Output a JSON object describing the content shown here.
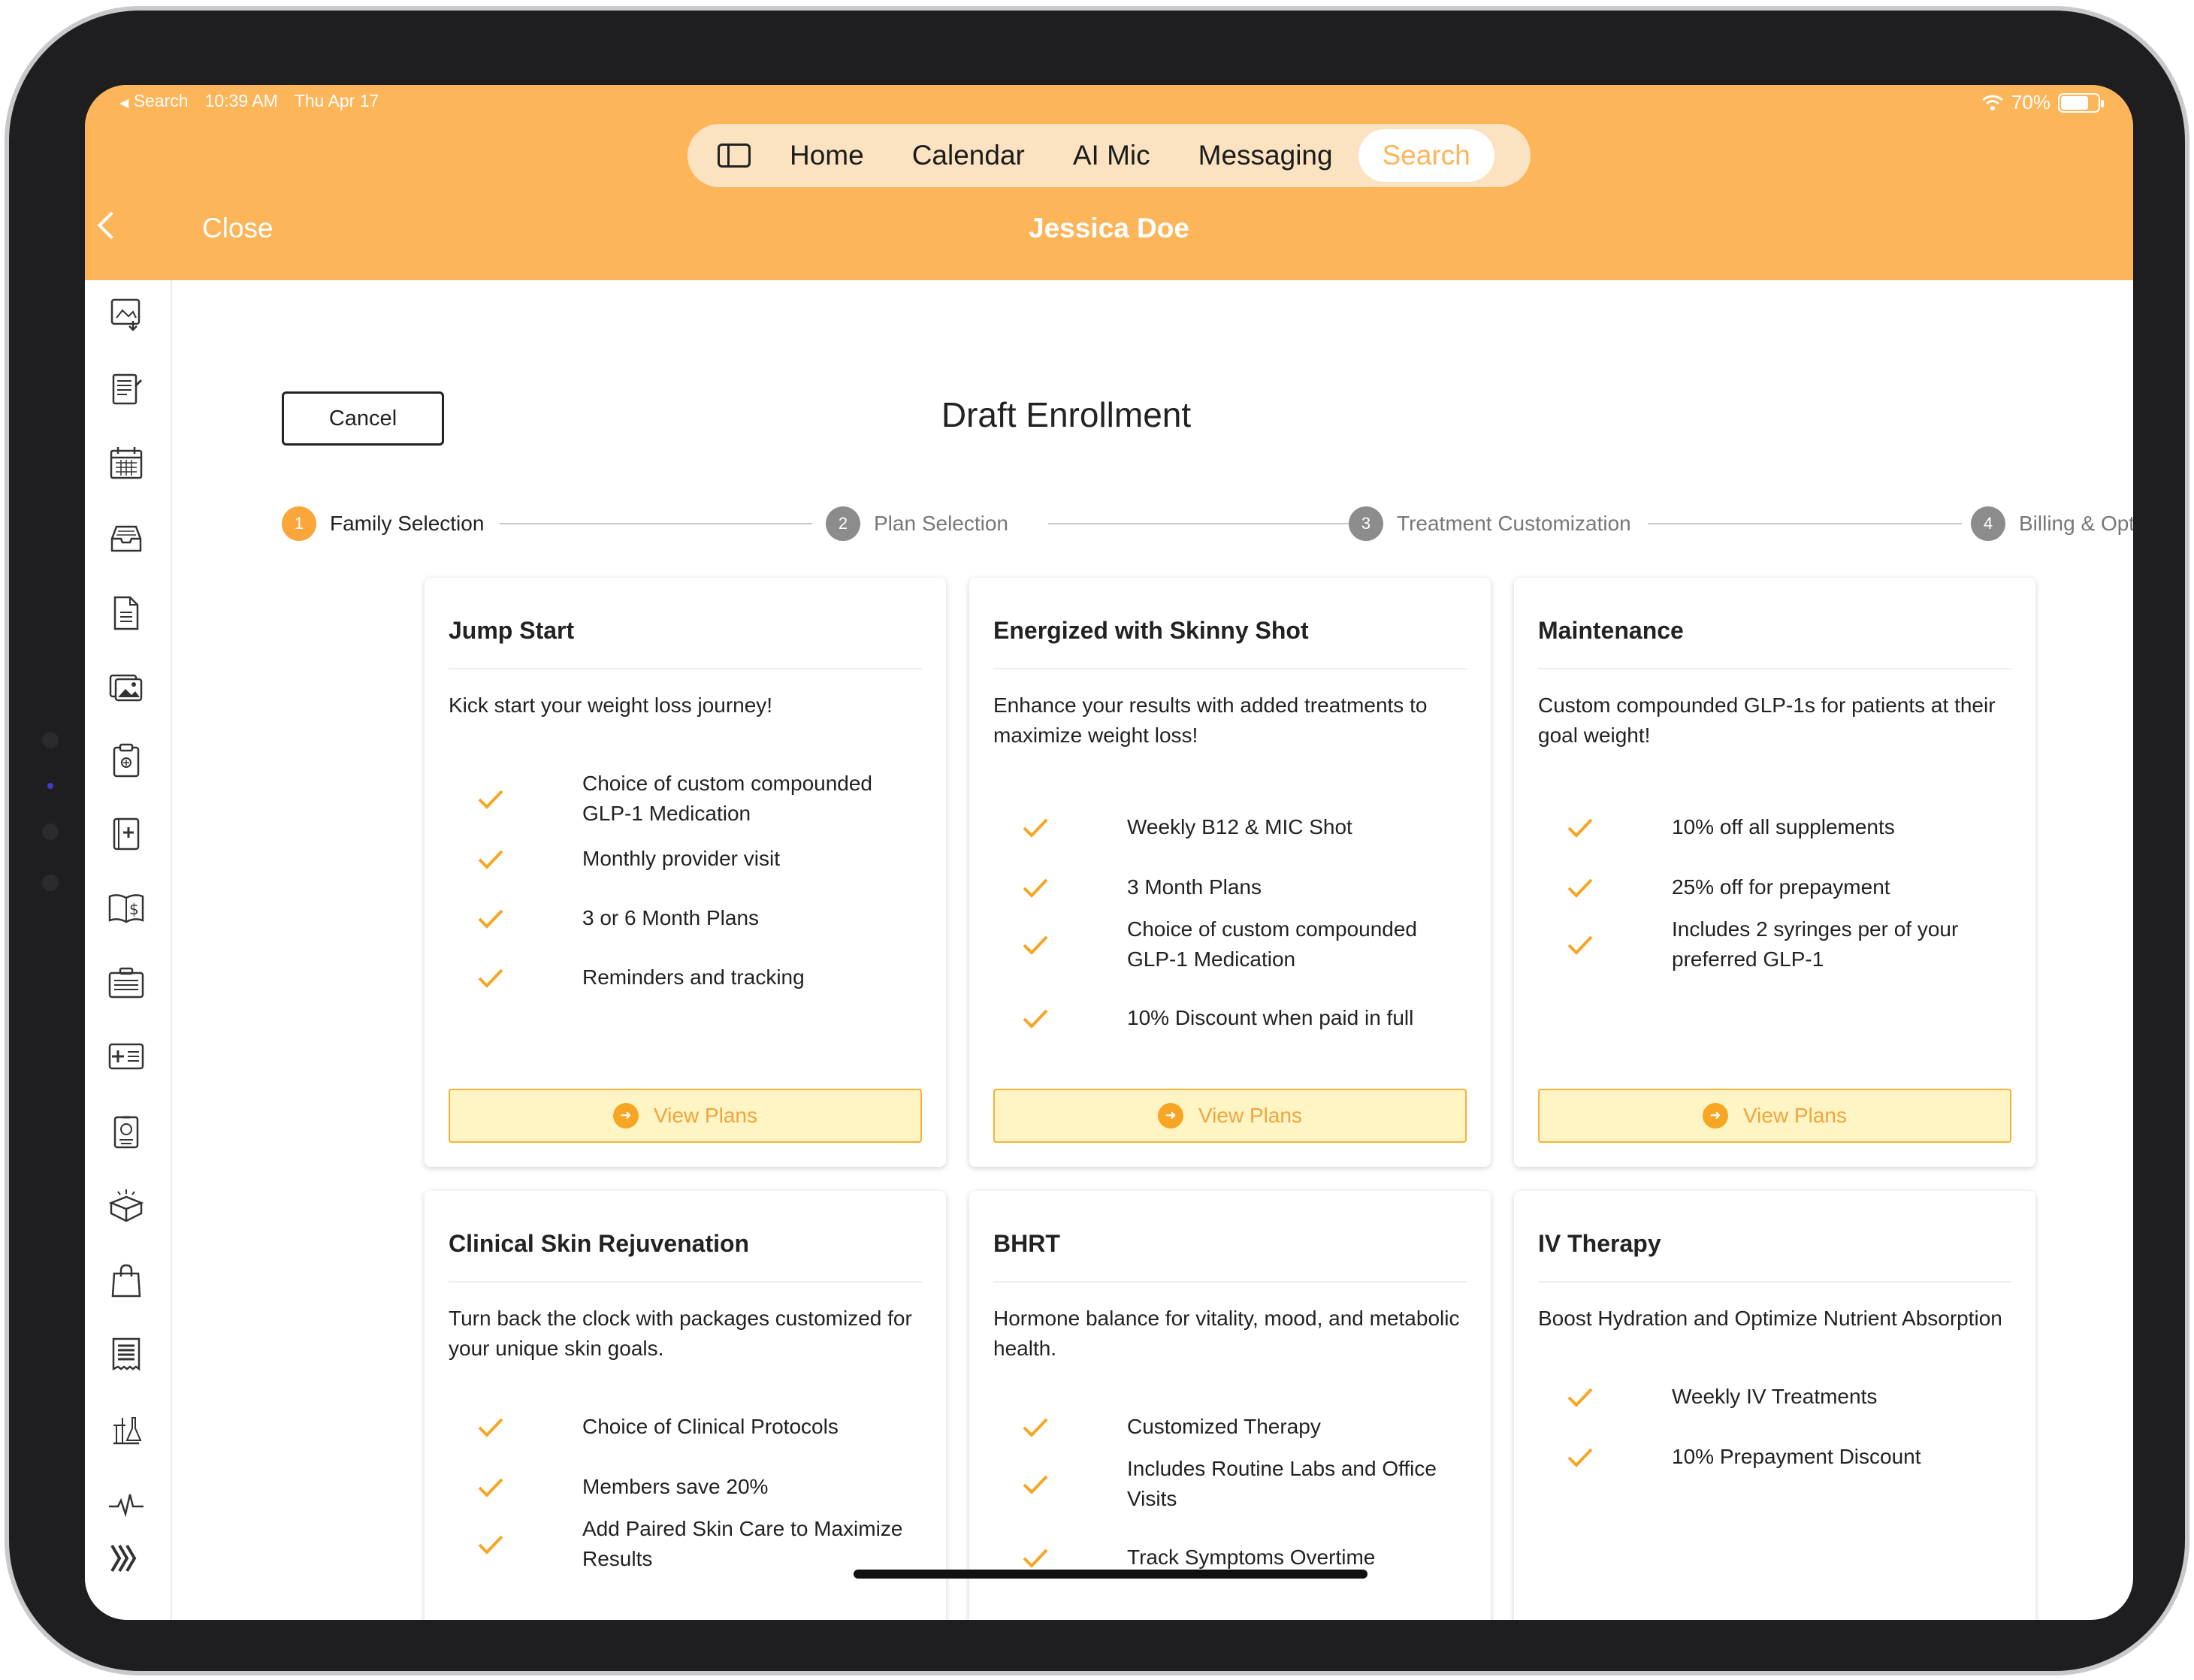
{
  "status_bar": {
    "back_app": "Search",
    "time": "10:39 AM",
    "date": "Thu Apr 17",
    "battery": "70%"
  },
  "top_tabs": [
    {
      "label": "Home",
      "active": false
    },
    {
      "label": "Calendar",
      "active": false
    },
    {
      "label": "AI Mic",
      "active": false
    },
    {
      "label": "Messaging",
      "active": false
    },
    {
      "label": "Search",
      "active": true
    }
  ],
  "nav": {
    "close_label": "Close",
    "patient_name": "Jessica Doe"
  },
  "page": {
    "title": "Draft Enrollment",
    "cancel_label": "Cancel"
  },
  "steps": [
    {
      "num": "1",
      "label": "Family Selection",
      "active": true
    },
    {
      "num": "2",
      "label": "Plan Selection",
      "active": false
    },
    {
      "num": "3",
      "label": "Treatment Customization",
      "active": false
    },
    {
      "num": "4",
      "label": "Billing & Options",
      "active": false
    }
  ],
  "view_plans_label": "View Plans",
  "cards": [
    {
      "title": "Jump Start",
      "description": "Kick start your weight loss journey!",
      "features": [
        "Choice of custom compounded GLP-1 Medication",
        "Monthly provider visit",
        "3 or 6 Month Plans",
        "Reminders and tracking"
      ]
    },
    {
      "title": "Energized with Skinny Shot",
      "description": "Enhance your results with added treatments to maximize weight loss!",
      "features": [
        "Weekly B12 & MIC Shot",
        "3 Month Plans",
        "Choice of custom compounded GLP-1 Medication",
        "10% Discount when paid in full"
      ]
    },
    {
      "title": "Maintenance",
      "description": "Custom compounded GLP-1s for patients at their goal weight!",
      "features": [
        "10% off all supplements",
        "25% off for prepayment",
        "Includes 2 syringes per of your preferred GLP-1"
      ]
    },
    {
      "title": "Clinical Skin Rejuvenation",
      "description": "Turn back the clock with packages customized for your unique skin goals.",
      "features": [
        "Choice of Clinical Protocols",
        "Members save 20%",
        "Add Paired Skin Care to Maximize Results"
      ]
    },
    {
      "title": "BHRT",
      "description": "Hormone balance for vitality, mood, and metabolic health.",
      "features": [
        "Customized Therapy",
        "Includes Routine Labs and Office Visits",
        "Track Symptoms Overtime"
      ]
    },
    {
      "title": "IV Therapy",
      "description": "Boost Hydration and Optimize Nutrient Absorption",
      "features": [
        "Weekly IV Treatments",
        "10% Prepayment Discount"
      ]
    }
  ],
  "rail_icons": [
    "image-download-icon",
    "notes-icon",
    "calendar-icon",
    "inbox-tray-icon",
    "document-icon",
    "photos-icon",
    "clipboard-icon",
    "medical-book-icon",
    "billing-book-icon",
    "briefcase-list-icon",
    "id-card-icon",
    "badge-icon",
    "package-icon",
    "shopping-bag-icon",
    "receipt-icon",
    "lab-icon",
    "vitals-icon",
    "expand-icon"
  ],
  "colors": {
    "header": "#fdb55a",
    "accent": "#f6a623",
    "button_fill": "#fff5c4"
  }
}
